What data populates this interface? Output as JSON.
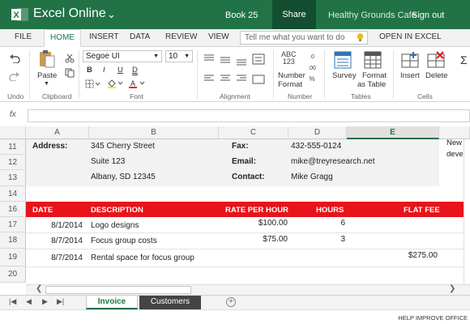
{
  "titlebar": {
    "app_name": "Excel Online",
    "book_name": "Book 25",
    "share": "Share",
    "company": "Healthy Grounds Cafe",
    "signout": "Sign out"
  },
  "tabs": {
    "file": "FILE",
    "home": "HOME",
    "insert": "INSERT",
    "data": "DATA",
    "review": "REVIEW",
    "view": "VIEW",
    "tell_me": "Tell me what you want to do",
    "open_in_excel": "OPEN IN EXCEL"
  },
  "ribbon": {
    "paste": "Paste",
    "undo": "Undo",
    "clipboard": "Clipboard",
    "font_name": "Segoe UI",
    "font_size": "10",
    "bold": "B",
    "italic": "I",
    "underline": "U",
    "double_underline": "D",
    "font": "Font",
    "alignment": "Alignment",
    "number_format_line1": "Number",
    "number_format_line2": "Format",
    "number_icon_text": "ABC\n123",
    "number": "Number",
    "survey": "Survey",
    "format_table_line1": "Format",
    "format_table_line2": "as Table",
    "tables": "Tables",
    "insert": "Insert",
    "delete": "Delete",
    "cells": "Cells",
    "sigma": "Σ"
  },
  "formula_bar": {
    "fx": "fx",
    "value": ""
  },
  "columns": [
    "A",
    "B",
    "C",
    "D",
    "E"
  ],
  "rows": [
    "11",
    "12",
    "13",
    "14",
    "16",
    "17",
    "18",
    "19",
    "20"
  ],
  "overflow_text": {
    "line1": "New",
    "line2": "deve"
  },
  "info": {
    "address_label": "Address:",
    "address_line1": "345 Cherry Street",
    "address_line2": "Suite 123",
    "address_line3": "Albany, SD 12345",
    "fax_label": "Fax:",
    "fax": "432-555-0124",
    "email_label": "Email:",
    "email": "mike@treyresearch.net",
    "contact_label": "Contact:",
    "contact": "Mike Gragg"
  },
  "table": {
    "headers": {
      "date": "DATE",
      "description": "DESCRIPTION",
      "rate": "RATE PER HOUR",
      "hours": "HOURS",
      "flat_fee": "FLAT FEE"
    },
    "rows": [
      {
        "date": "8/1/2014",
        "description": "Logo designs",
        "rate": "$100.00",
        "hours": "6",
        "flat_fee": ""
      },
      {
        "date": "8/7/2014",
        "description": "Focus group costs",
        "rate": "$75.00",
        "hours": "3",
        "flat_fee": ""
      },
      {
        "date": "8/7/2014",
        "description": "Rental space for focus group",
        "rate": "",
        "hours": "",
        "flat_fee": "$275.00"
      }
    ]
  },
  "sheets": [
    "Invoice",
    "Customers"
  ],
  "status": {
    "help": "HELP IMPROVE OFFICE"
  },
  "colors": {
    "excel_green": "#217346",
    "header_red": "#e8131b",
    "dark_tab": "#444444"
  }
}
